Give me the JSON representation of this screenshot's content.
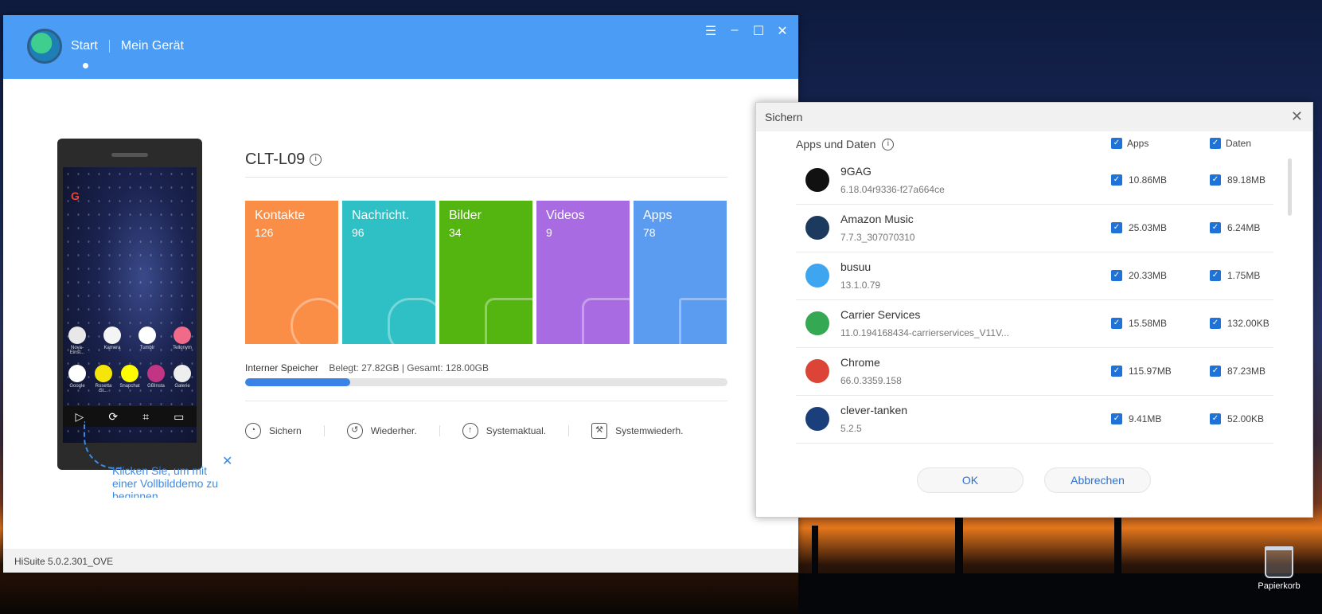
{
  "app": {
    "nav_start": "Start",
    "nav_device": "Mein Gerät",
    "version": "HiSuite 5.0.2.301_OVE"
  },
  "device": {
    "name": "CLT-L09",
    "demo_hint": "Klicken Sie, um mit einer Vollbilddemo zu beginnen",
    "phone_apps_row1": [
      "Nova-Einst...",
      "Kamera",
      "Tumblr",
      "Tellonym"
    ],
    "phone_apps_row2": [
      "Google",
      "Rosetta St...",
      "Snapchat",
      "GBInsta",
      "Galerie"
    ]
  },
  "tiles": [
    {
      "label": "Kontakte",
      "count": "126",
      "color": "#fb8e47"
    },
    {
      "label": "Nachricht.",
      "count": "96",
      "color": "#2ec0c4"
    },
    {
      "label": "Bilder",
      "count": "34",
      "color": "#54b510"
    },
    {
      "label": "Videos",
      "count": "9",
      "color": "#a86be2"
    },
    {
      "label": "Apps",
      "count": "78",
      "color": "#5b9cf0"
    }
  ],
  "storage": {
    "label": "Interner Speicher",
    "detail": "Belegt: 27.82GB | Gesamt: 128.00GB",
    "used_fraction": 0.217
  },
  "actions": [
    {
      "label": "Sichern",
      "icon": "backup-icon"
    },
    {
      "label": "Wiederher.",
      "icon": "restore-icon"
    },
    {
      "label": "Systemaktual.",
      "icon": "update-icon"
    },
    {
      "label": "Systemwiederh.",
      "icon": "wrench-icon"
    }
  ],
  "dialog": {
    "title": "Sichern",
    "section_label": "Apps und Daten",
    "col_apps": "Apps",
    "col_data": "Daten",
    "ok": "OK",
    "cancel": "Abbrechen",
    "apps": [
      {
        "name": "9GAG",
        "version": "6.18.04r9336-f27a664ce",
        "app_size": "10.86MB",
        "data_size": "89.18MB",
        "icon_color": "#111111"
      },
      {
        "name": "Amazon Music",
        "version": "7.7.3_307070310",
        "app_size": "25.03MB",
        "data_size": "6.24MB",
        "icon_color": "#1c3a5e"
      },
      {
        "name": "busuu",
        "version": "13.1.0.79",
        "app_size": "20.33MB",
        "data_size": "1.75MB",
        "icon_color": "#3ea6f0"
      },
      {
        "name": "Carrier Services",
        "version": "11.0.194168434-carrierservices_V11V...",
        "app_size": "15.58MB",
        "data_size": "132.00KB",
        "icon_color": "#34a853"
      },
      {
        "name": "Chrome",
        "version": "66.0.3359.158",
        "app_size": "115.97MB",
        "data_size": "87.23MB",
        "icon_color": "#db4437"
      },
      {
        "name": "clever-tanken",
        "version": "5.2.5",
        "app_size": "9.41MB",
        "data_size": "52.00KB",
        "icon_color": "#1a3f7a"
      }
    ]
  },
  "desktop": {
    "recycle_bin": "Papierkorb"
  }
}
